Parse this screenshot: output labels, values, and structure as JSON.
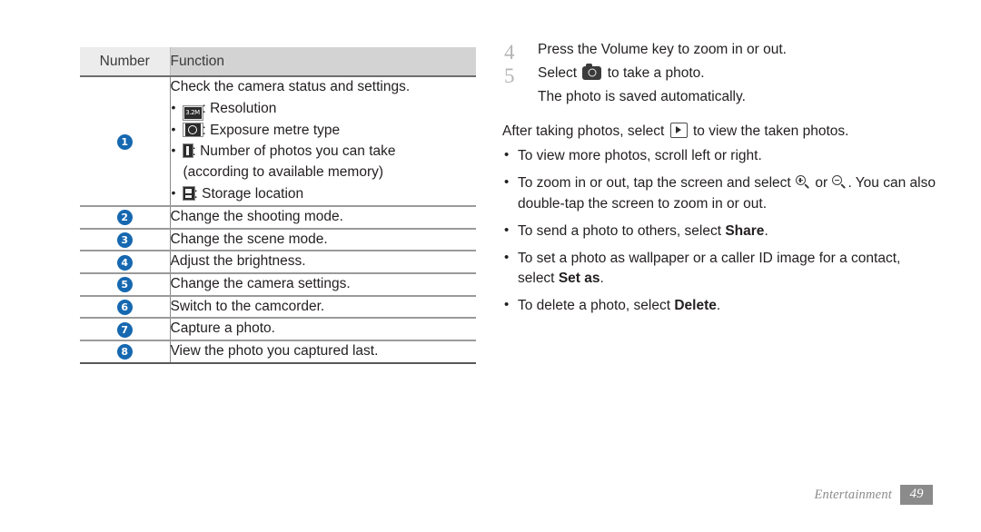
{
  "table": {
    "headers": [
      "Number",
      "Function"
    ],
    "rows": [
      {
        "number": "1",
        "lead": "Check the camera status and settings.",
        "items": [
          {
            "icon": "resolution-icon",
            "icon_text": "3.2M",
            "text": ": Resolution"
          },
          {
            "icon": "exposure-metre-icon",
            "icon_text": "",
            "text": ": Exposure metre type"
          },
          {
            "icon": "photo-count-icon",
            "icon_text": "",
            "text": ": Number of photos you can take",
            "sub": "(according to available memory)"
          },
          {
            "icon": "storage-location-icon",
            "icon_text": "",
            "text": ": Storage location"
          }
        ]
      },
      {
        "number": "2",
        "lead": "Change the shooting mode."
      },
      {
        "number": "3",
        "lead": "Change the scene mode."
      },
      {
        "number": "4",
        "lead": "Adjust the brightness."
      },
      {
        "number": "5",
        "lead": "Change the camera settings."
      },
      {
        "number": "6",
        "lead": "Switch to the camcorder."
      },
      {
        "number": "7",
        "lead": "Capture a photo."
      },
      {
        "number": "8",
        "lead": "View the photo you captured last."
      }
    ]
  },
  "steps": [
    {
      "num": "4",
      "text": "Press the Volume key to zoom in or out.",
      "note": ""
    },
    {
      "num": "5",
      "text_before": "Select",
      "text_after": "to take a photo.",
      "note": "The photo is saved automatically."
    }
  ],
  "after": {
    "before": "After taking photos, select",
    "after": "to view the taken photos."
  },
  "bullets": [
    {
      "text": "To view more photos, scroll left or right."
    },
    {
      "part1": "To zoom in or out, tap the screen and select",
      "part2": "or",
      "part3": ". You can also double-tap the screen to zoom in or out."
    },
    {
      "before": "To send a photo to others, select",
      "bold": "Share",
      "after": "."
    },
    {
      "before": "To set a photo as wallpaper or a caller ID image for a contact, select",
      "bold": "Set as",
      "after": "."
    },
    {
      "before": "To delete a photo, select",
      "bold": "Delete",
      "after": "."
    }
  ],
  "footer": {
    "label": "Entertainment",
    "page": "49"
  },
  "colors": {
    "badge_blue": "#1668b0",
    "header_gray": "#d3d3d3",
    "footer_gray": "#8b8b8b"
  }
}
